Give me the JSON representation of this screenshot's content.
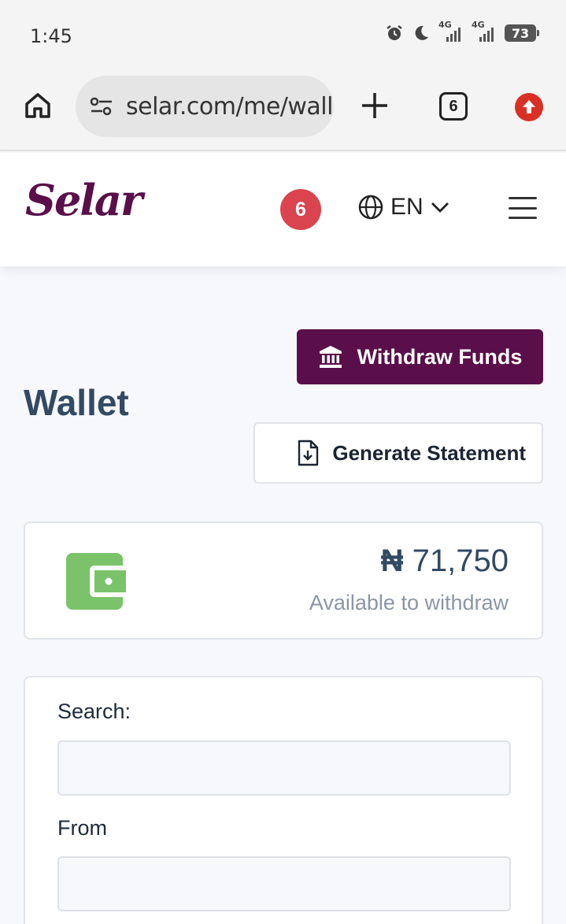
{
  "status_bar": {
    "time": "1:45",
    "network_1": "4G",
    "network_2": "4G",
    "battery": "73"
  },
  "browser": {
    "url": "selar.com/me/wallet",
    "tab_count": "6"
  },
  "header": {
    "logo": "Selar",
    "notification_count": "6",
    "language": "EN"
  },
  "page": {
    "title": "Wallet",
    "withdraw_label": "Withdraw Funds",
    "statement_label": "Generate Statement"
  },
  "balance": {
    "currency": "₦",
    "amount": "71,750",
    "caption": "Available to withdraw"
  },
  "filters": {
    "search_label": "Search:",
    "search_value": "",
    "from_label": "From",
    "from_value": ""
  },
  "colors": {
    "brand": "#5a0f4a",
    "badge": "#d9444f",
    "wallet_green": "#7ac36a",
    "title": "#324a63"
  }
}
